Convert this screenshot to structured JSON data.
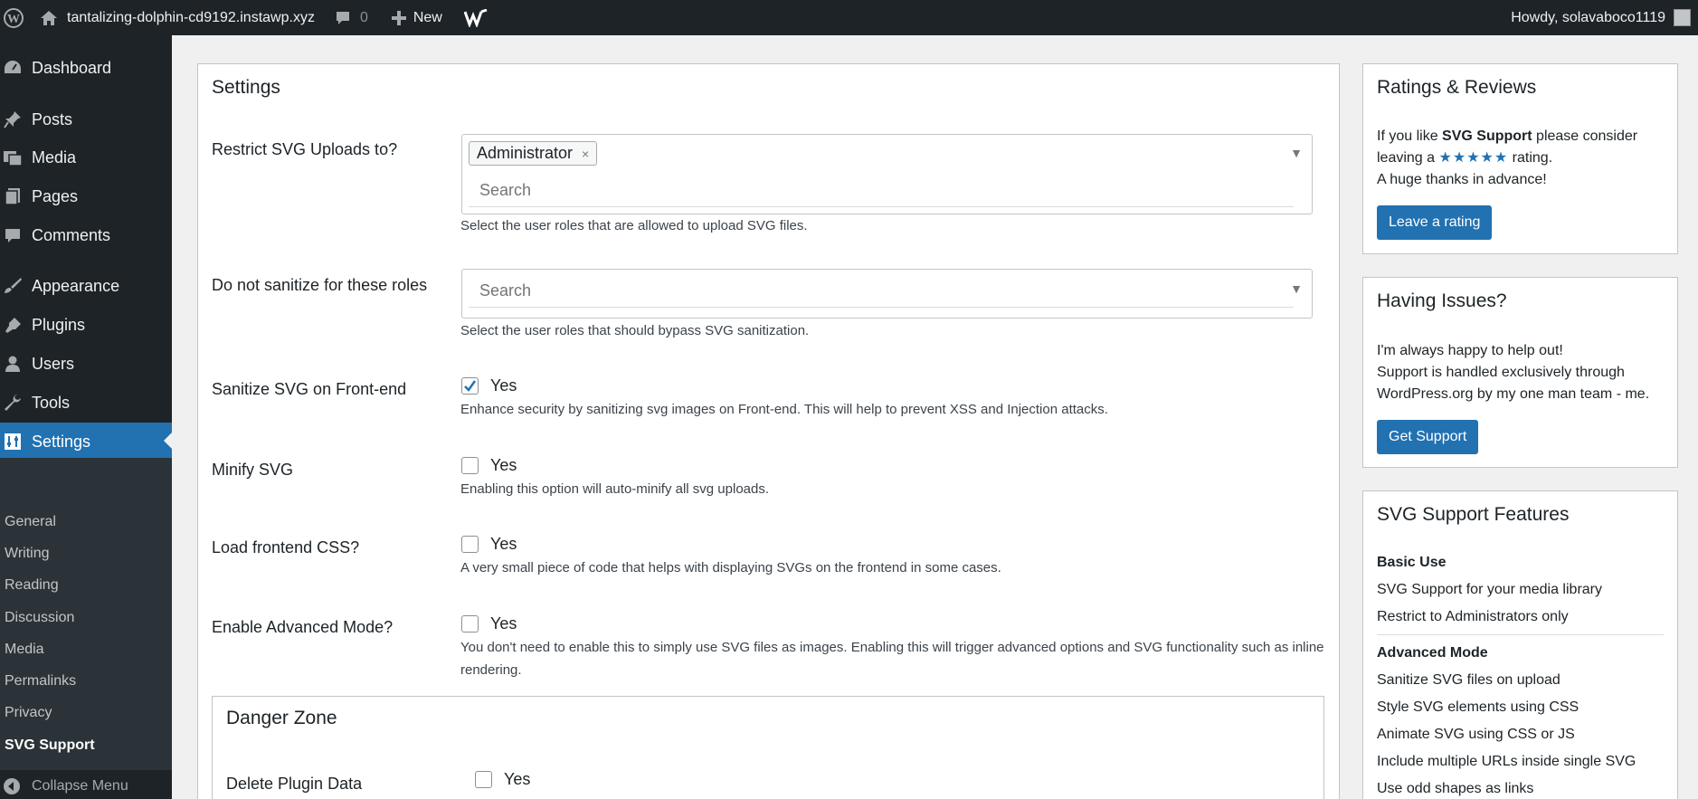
{
  "adminbar": {
    "site_name": "tantalizing-dolphin-cd9192.instawp.xyz",
    "comments_count": "0",
    "new_label": "New",
    "howdy": "Howdy, solavaboco1119"
  },
  "sidebar": {
    "menu": {
      "dashboard": "Dashboard",
      "posts": "Posts",
      "media": "Media",
      "pages": "Pages",
      "comments": "Comments",
      "appearance": "Appearance",
      "plugins": "Plugins",
      "users": "Users",
      "tools": "Tools",
      "settings": "Settings"
    },
    "submenu": {
      "general": "General",
      "writing": "Writing",
      "reading": "Reading",
      "discussion": "Discussion",
      "media": "Media",
      "permalinks": "Permalinks",
      "privacy": "Privacy",
      "svg_support": "SVG Support"
    },
    "collapse": "Collapse Menu"
  },
  "settings": {
    "title": "Settings",
    "restrict": {
      "label": "Restrict SVG Uploads to?",
      "tag": "Administrator",
      "tag_remove": "×",
      "search": "Search",
      "desc": "Select the user roles that are allowed to upload SVG files."
    },
    "no_sanitize": {
      "label": "Do not sanitize for these roles",
      "search": "Search",
      "desc": "Select the user roles that should bypass SVG sanitization."
    },
    "sanitize_front": {
      "label": "Sanitize SVG on Front-end",
      "checkbox_label": "Yes",
      "checked": true,
      "desc": "Enhance security by sanitizing svg images on Front-end. This will help to prevent XSS and Injection attacks."
    },
    "minify": {
      "label": "Minify SVG",
      "checkbox_label": "Yes",
      "checked": false,
      "desc": "Enabling this option will auto-minify all svg uploads."
    },
    "frontend_css": {
      "label": "Load frontend CSS?",
      "checkbox_label": "Yes",
      "checked": false,
      "desc": "A very small piece of code that helps with displaying SVGs on the frontend in some cases."
    },
    "advanced": {
      "label": "Enable Advanced Mode?",
      "checkbox_label": "Yes",
      "checked": false,
      "desc_line1": "You don't need to enable this to simply use SVG files as images. Enabling this will trigger advanced options and SVG functionality such as inline",
      "desc_line2": "rendering."
    },
    "danger": {
      "title": "Danger Zone",
      "delete_label": "Delete Plugin Data",
      "checkbox_label": "Yes",
      "checked": false
    }
  },
  "ratings": {
    "title": "Ratings & Reviews",
    "text_pre": "If you like ",
    "text_bold": "SVG Support",
    "text_post": " please consider",
    "line2_pre": "leaving a ",
    "stars": "★★★★★",
    "line2_post": " rating.",
    "line3": "A huge thanks in advance!",
    "button": "Leave a rating"
  },
  "issues": {
    "title": "Having Issues?",
    "line1": "I'm always happy to help out!",
    "line2": "Support is handled exclusively through",
    "line3": "WordPress.org by my one man team - me.",
    "button": "Get Support"
  },
  "features": {
    "title": "SVG Support Features",
    "basic_head": "Basic Use",
    "basic_items": [
      "SVG Support for your media library",
      "Restrict to Administrators only"
    ],
    "advanced_head": "Advanced Mode",
    "advanced_items": [
      "Sanitize SVG files on upload",
      "Style SVG elements using CSS",
      "Animate SVG using CSS or JS",
      "Include multiple URLs inside single SVG",
      "Use odd shapes as links"
    ]
  },
  "colors": {
    "admin_dark": "#1d2327",
    "accent": "#2271b1",
    "background": "#f0f0f1"
  }
}
